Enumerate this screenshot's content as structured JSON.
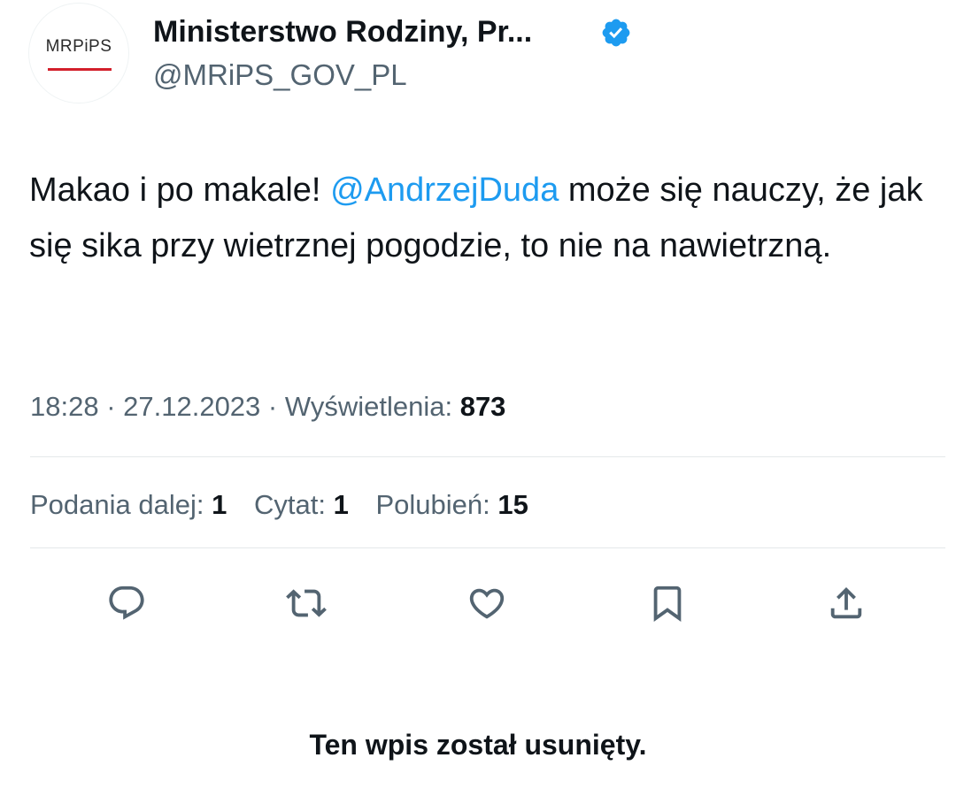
{
  "author": {
    "display_name": "Ministerstwo Rodziny, Pr...",
    "handle": "@MRiPS_GOV_PL",
    "avatar_text": "MRPiPS",
    "verified": true
  },
  "tweet": {
    "text_before": "Makao i po makale! ",
    "mention": "@AndrzejDuda",
    "text_after": " może się nauczy, że jak się sika przy wietrznej pogodzie, to nie na nawietrzną."
  },
  "meta": {
    "time": "18:28",
    "separator": " · ",
    "date": "27.12.2023",
    "views_label": "Wyświetlenia: ",
    "views_count": "873"
  },
  "stats": {
    "retweets_label": "Podania dalej: ",
    "retweets_count": "1",
    "quotes_label": "Cytat: ",
    "quotes_count": "1",
    "likes_label": "Polubień: ",
    "likes_count": "15"
  },
  "actions": [
    {
      "icon": "reply-icon"
    },
    {
      "icon": "retweet-icon"
    },
    {
      "icon": "like-icon"
    },
    {
      "icon": "bookmark-icon"
    },
    {
      "icon": "share-icon"
    }
  ],
  "notice": {
    "deleted_text": "Ten wpis został usunięty."
  },
  "colors": {
    "accent": "#1d9bf0",
    "text_primary": "#0f1419",
    "text_secondary": "#536471",
    "avatar_line": "#d31f2b"
  }
}
